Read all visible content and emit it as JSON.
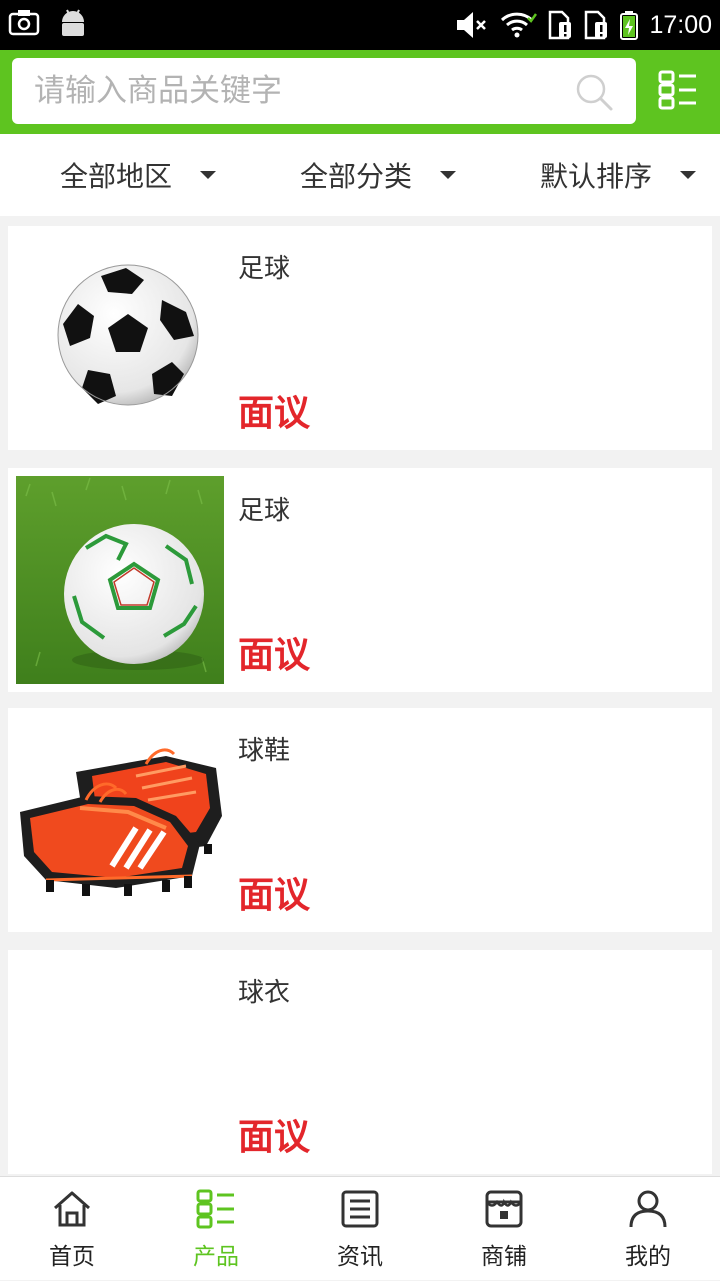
{
  "status_bar": {
    "time": "17:00",
    "icons": [
      "screenshot-icon",
      "android-icon",
      "mute-icon",
      "wifi-icon",
      "sim-alert-icon",
      "sim-alert-icon",
      "battery-charging-icon"
    ]
  },
  "search": {
    "placeholder": "请输入商品关键字",
    "value": ""
  },
  "filters": [
    {
      "label": "全部地区"
    },
    {
      "label": "全部分类"
    },
    {
      "label": "默认排序"
    }
  ],
  "products": [
    {
      "name": "足球",
      "price": "面议",
      "image": "soccer-ball-black-white"
    },
    {
      "name": "足球",
      "price": "面议",
      "image": "soccer-ball-on-grass"
    },
    {
      "name": "球鞋",
      "price": "面议",
      "image": "orange-football-boots"
    },
    {
      "name": "球衣",
      "price": "面议",
      "image": ""
    }
  ],
  "nav": {
    "items": [
      {
        "label": "首页",
        "icon": "home-icon",
        "active": false
      },
      {
        "label": "产品",
        "icon": "product-list-icon",
        "active": true
      },
      {
        "label": "资讯",
        "icon": "news-icon",
        "active": false
      },
      {
        "label": "商铺",
        "icon": "shop-icon",
        "active": false
      },
      {
        "label": "我的",
        "icon": "user-icon",
        "active": false
      }
    ]
  },
  "colors": {
    "brand_green": "#5ec420",
    "price_red": "#e3262b"
  }
}
